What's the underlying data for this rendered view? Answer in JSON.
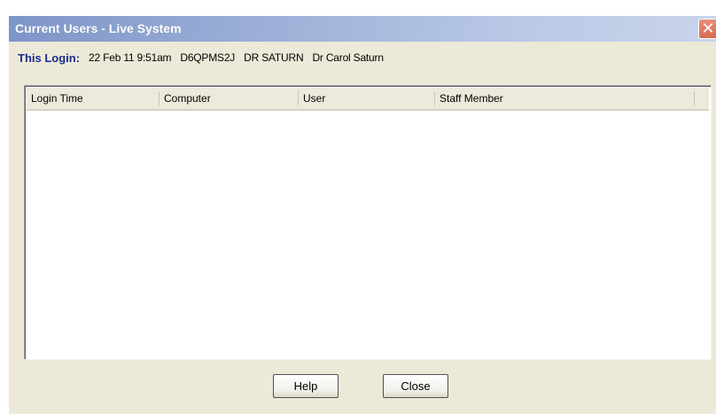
{
  "window": {
    "title": "Current Users - Live System",
    "close_glyph": "✕"
  },
  "login": {
    "label": "This Login:",
    "datetime": "22 Feb 11 9:51am",
    "computer": "D6QPMS2J",
    "user": "DR SATURN",
    "staff": "Dr Carol Saturn"
  },
  "table": {
    "columns": [
      "Login Time",
      "Computer",
      "User",
      "Staff Member"
    ],
    "rows": []
  },
  "buttons": {
    "help": "Help",
    "close": "Close"
  },
  "colors": {
    "title_text": "#ffffff",
    "login_label": "#1a2d8f",
    "dialog_bg": "#ece9d8"
  }
}
